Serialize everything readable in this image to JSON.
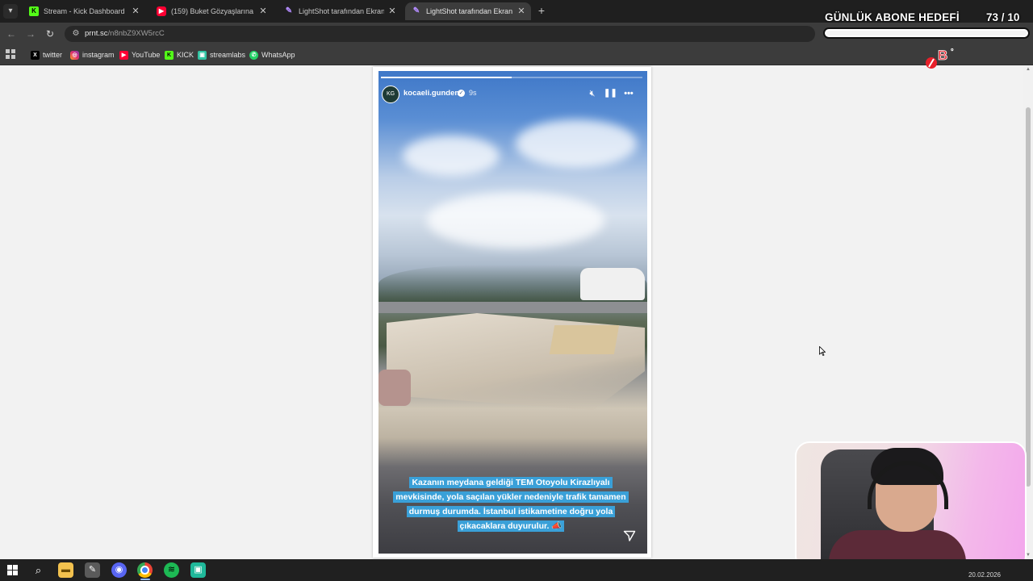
{
  "browser": {
    "tabs": [
      {
        "title": "Stream - Kick Dashboard",
        "favicon": "kick-icon",
        "active": false
      },
      {
        "title": "(159) Buket Gözyaşlarına Boğuldu",
        "favicon": "youtube-icon",
        "active": false
      },
      {
        "title": "LightShot tarafından Ekran Görüntüsü",
        "favicon": "lightshot-icon",
        "active": false
      },
      {
        "title": "LightShot tarafından Ekran Görüntüsü",
        "favicon": "lightshot-icon",
        "active": true
      }
    ],
    "url": {
      "host": "prnt.sc",
      "path": "/n8nbZ9XW5rcC"
    },
    "bookmarks": [
      {
        "label": "twitter",
        "icon": "x-icon"
      },
      {
        "label": "instagram",
        "icon": "instagram-icon"
      },
      {
        "label": "YouTube",
        "icon": "youtube-icon"
      },
      {
        "label": "KICK",
        "icon": "kick-icon"
      },
      {
        "label": "streamlabs",
        "icon": "streamlabs-icon"
      },
      {
        "label": "WhatsApp",
        "icon": "whatsapp-icon"
      }
    ]
  },
  "story": {
    "username": "kocaeli.gundem",
    "time": "9s",
    "progress": 0.5,
    "caption": "Kazanın meydana geldiği TEM Otoyolu Kirazlıyalı mevkisinde, yola saçılan yükler nedeniyle trafik tamamen durmuş durumda. İstanbul istikametine doğru yola çıkacaklara duyurulur. 📣",
    "controls": [
      "mute-icon",
      "pause-icon",
      "more-icon"
    ]
  },
  "overlay": {
    "goal_title": "GÜNLÜK ABONE HEDEFİ",
    "goal_current": "73",
    "goal_separator": "/",
    "goal_target": "10",
    "goal_fraction": 1.0
  },
  "taskbar": {
    "date": "20.02.2026",
    "icons": [
      "windows-start-icon",
      "search-icon",
      "file-explorer-icon",
      "app-icon",
      "discord-icon",
      "chrome-icon",
      "spotify-icon",
      "app2-icon"
    ]
  },
  "colors": {
    "chrome_bg": "#1f1f1f",
    "toolbar_bg": "#3c3c3c",
    "caption_bg": "#3aa0d8",
    "webcam_accent": "#f3a6ec"
  }
}
